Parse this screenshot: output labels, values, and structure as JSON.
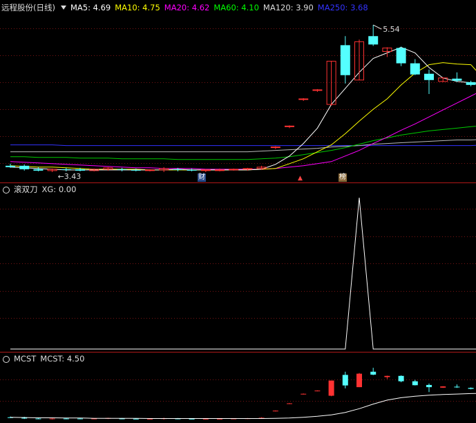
{
  "header": {
    "stock_name": "远程股份(日线)",
    "ma_items": [
      {
        "label": "MA5: 4.69",
        "color": "#ffffff"
      },
      {
        "label": "MA10: 4.75",
        "color": "#ffff00"
      },
      {
        "label": "MA20: 4.62",
        "color": "#ff00ff"
      },
      {
        "label": "MA60: 4.10",
        "color": "#00ff00"
      },
      {
        "label": "MA120: 3.90",
        "color": "#dddddd"
      },
      {
        "label": "MA250: 3.68",
        "color": "#3333ff"
      }
    ]
  },
  "panel2": {
    "name": "滚双刀",
    "value_label": "XG: 0.00"
  },
  "panel3": {
    "name": "MCST",
    "value_label": "MCST: 4.50"
  },
  "annotations": {
    "high_label": "5.54",
    "low_label": "3.43",
    "badge_cai": "财",
    "badge_bang": "榜"
  },
  "chart_data": {
    "type": "candlestick",
    "up_color": "#ff3232",
    "down_color": "#54ffff",
    "ylim": [
      3.3,
      5.7
    ],
    "candles": [
      {
        "o": 3.52,
        "h": 3.55,
        "l": 3.49,
        "c": 3.5
      },
      {
        "o": 3.52,
        "h": 3.54,
        "l": 3.45,
        "c": 3.47
      },
      {
        "o": 3.47,
        "h": 3.5,
        "l": 3.44,
        "c": 3.45
      },
      {
        "o": 3.45,
        "h": 3.48,
        "l": 3.43,
        "c": 3.47
      },
      {
        "o": 3.47,
        "h": 3.49,
        "l": 3.44,
        "c": 3.46
      },
      {
        "o": 3.47,
        "h": 3.49,
        "l": 3.44,
        "c": 3.45
      },
      {
        "o": 3.45,
        "h": 3.48,
        "l": 3.44,
        "c": 3.47
      },
      {
        "o": 3.47,
        "h": 3.5,
        "l": 3.45,
        "c": 3.49
      },
      {
        "o": 3.47,
        "h": 3.49,
        "l": 3.44,
        "c": 3.46
      },
      {
        "o": 3.46,
        "h": 3.48,
        "l": 3.44,
        "c": 3.45
      },
      {
        "o": 3.45,
        "h": 3.47,
        "l": 3.44,
        "c": 3.46
      },
      {
        "o": 3.46,
        "h": 3.5,
        "l": 3.43,
        "c": 3.48
      },
      {
        "o": 3.47,
        "h": 3.49,
        "l": 3.44,
        "c": 3.46
      },
      {
        "o": 3.46,
        "h": 3.48,
        "l": 3.44,
        "c": 3.45
      },
      {
        "o": 3.45,
        "h": 3.47,
        "l": 3.43,
        "c": 3.46
      },
      {
        "o": 3.46,
        "h": 3.48,
        "l": 3.44,
        "c": 3.46
      },
      {
        "o": 3.46,
        "h": 3.48,
        "l": 3.45,
        "c": 3.47
      },
      {
        "o": 3.47,
        "h": 3.49,
        "l": 3.45,
        "c": 3.48
      },
      {
        "o": 3.48,
        "h": 3.52,
        "l": 3.46,
        "c": 3.5
      },
      {
        "o": 3.78,
        "h": 3.8,
        "l": 3.76,
        "c": 3.79
      },
      {
        "o": 4.08,
        "h": 4.1,
        "l": 4.06,
        "c": 4.09
      },
      {
        "o": 4.47,
        "h": 4.49,
        "l": 4.45,
        "c": 4.48
      },
      {
        "o": 4.6,
        "h": 4.62,
        "l": 4.58,
        "c": 4.61
      },
      {
        "o": 4.4,
        "h": 5.02,
        "l": 4.38,
        "c": 5.02
      },
      {
        "o": 5.25,
        "h": 5.38,
        "l": 4.7,
        "c": 4.82
      },
      {
        "o": 4.75,
        "h": 5.33,
        "l": 4.75,
        "c": 5.3
      },
      {
        "o": 5.38,
        "h": 5.54,
        "l": 5.24,
        "c": 5.26
      },
      {
        "o": 5.16,
        "h": 5.22,
        "l": 5.08,
        "c": 5.21
      },
      {
        "o": 5.21,
        "h": 5.23,
        "l": 4.95,
        "c": 4.99
      },
      {
        "o": 4.99,
        "h": 5.05,
        "l": 4.82,
        "c": 4.83
      },
      {
        "o": 4.84,
        "h": 4.9,
        "l": 4.55,
        "c": 4.75
      },
      {
        "o": 4.73,
        "h": 4.79,
        "l": 4.72,
        "c": 4.78
      },
      {
        "o": 4.77,
        "h": 4.86,
        "l": 4.72,
        "c": 4.74
      },
      {
        "o": 4.72,
        "h": 4.74,
        "l": 4.66,
        "c": 4.68
      },
      {
        "o": 4.63,
        "h": 4.72,
        "l": 4.63,
        "c": 4.7
      }
    ],
    "ma5": [
      3.5,
      3.49,
      3.48,
      3.47,
      3.46,
      3.46,
      3.46,
      3.46,
      3.46,
      3.46,
      3.46,
      3.46,
      3.47,
      3.46,
      3.46,
      3.46,
      3.46,
      3.46,
      3.47,
      3.54,
      3.66,
      3.84,
      4.06,
      4.4,
      4.63,
      4.86,
      5.06,
      5.14,
      5.22,
      5.14,
      4.93,
      4.78,
      4.73,
      4.71,
      4.69
    ],
    "ma10": [
      3.52,
      3.51,
      3.5,
      3.5,
      3.49,
      3.48,
      3.47,
      3.47,
      3.47,
      3.47,
      3.46,
      3.46,
      3.46,
      3.46,
      3.46,
      3.46,
      3.46,
      3.46,
      3.47,
      3.48,
      3.55,
      3.62,
      3.72,
      3.82,
      3.98,
      4.16,
      4.33,
      4.48,
      4.68,
      4.85,
      4.97,
      5.0,
      4.98,
      4.97,
      4.75
    ],
    "ma20": [
      3.58,
      3.57,
      3.56,
      3.55,
      3.54,
      3.53,
      3.52,
      3.51,
      3.5,
      3.49,
      3.49,
      3.48,
      3.48,
      3.48,
      3.47,
      3.47,
      3.47,
      3.47,
      3.47,
      3.48,
      3.5,
      3.52,
      3.55,
      3.58,
      3.66,
      3.74,
      3.84,
      3.93,
      4.03,
      4.12,
      4.22,
      4.32,
      4.42,
      4.52,
      4.62
    ],
    "ma60": [
      3.65,
      3.65,
      3.64,
      3.64,
      3.64,
      3.63,
      3.63,
      3.63,
      3.62,
      3.62,
      3.62,
      3.62,
      3.61,
      3.61,
      3.61,
      3.61,
      3.61,
      3.61,
      3.62,
      3.63,
      3.65,
      3.68,
      3.71,
      3.74,
      3.78,
      3.83,
      3.88,
      3.92,
      3.96,
      3.99,
      4.02,
      4.04,
      4.06,
      4.08,
      4.1
    ],
    "ma120": [
      3.72,
      3.72,
      3.72,
      3.72,
      3.72,
      3.72,
      3.72,
      3.72,
      3.72,
      3.72,
      3.72,
      3.72,
      3.72,
      3.72,
      3.72,
      3.72,
      3.72,
      3.72,
      3.73,
      3.74,
      3.75,
      3.76,
      3.77,
      3.79,
      3.8,
      3.81,
      3.83,
      3.84,
      3.85,
      3.86,
      3.87,
      3.88,
      3.89,
      3.89,
      3.9
    ],
    "ma250": [
      3.82,
      3.82,
      3.82,
      3.82,
      3.81,
      3.81,
      3.81,
      3.81,
      3.81,
      3.81,
      3.81,
      3.81,
      3.81,
      3.81,
      3.81,
      3.81,
      3.81,
      3.81,
      3.81,
      3.81,
      3.81,
      3.81,
      3.81,
      3.81,
      3.81,
      3.81,
      3.81,
      3.81,
      3.81,
      3.81,
      3.81,
      3.81,
      3.81,
      3.81,
      3.82
    ],
    "xg": [
      0,
      0,
      0,
      0,
      0,
      0,
      0,
      0,
      0,
      0,
      0,
      0,
      0,
      0,
      0,
      0,
      0,
      0,
      0,
      0,
      0,
      0,
      0,
      0,
      0,
      1,
      0,
      0,
      0,
      0,
      0,
      0,
      0,
      0,
      0
    ],
    "mcst": [
      3.52,
      3.51,
      3.5,
      3.5,
      3.49,
      3.49,
      3.48,
      3.48,
      3.48,
      3.48,
      3.47,
      3.47,
      3.47,
      3.47,
      3.47,
      3.47,
      3.47,
      3.47,
      3.47,
      3.48,
      3.49,
      3.52,
      3.56,
      3.62,
      3.72,
      3.87,
      4.06,
      4.22,
      4.32,
      4.38,
      4.42,
      4.45,
      4.47,
      4.49,
      4.5
    ]
  }
}
